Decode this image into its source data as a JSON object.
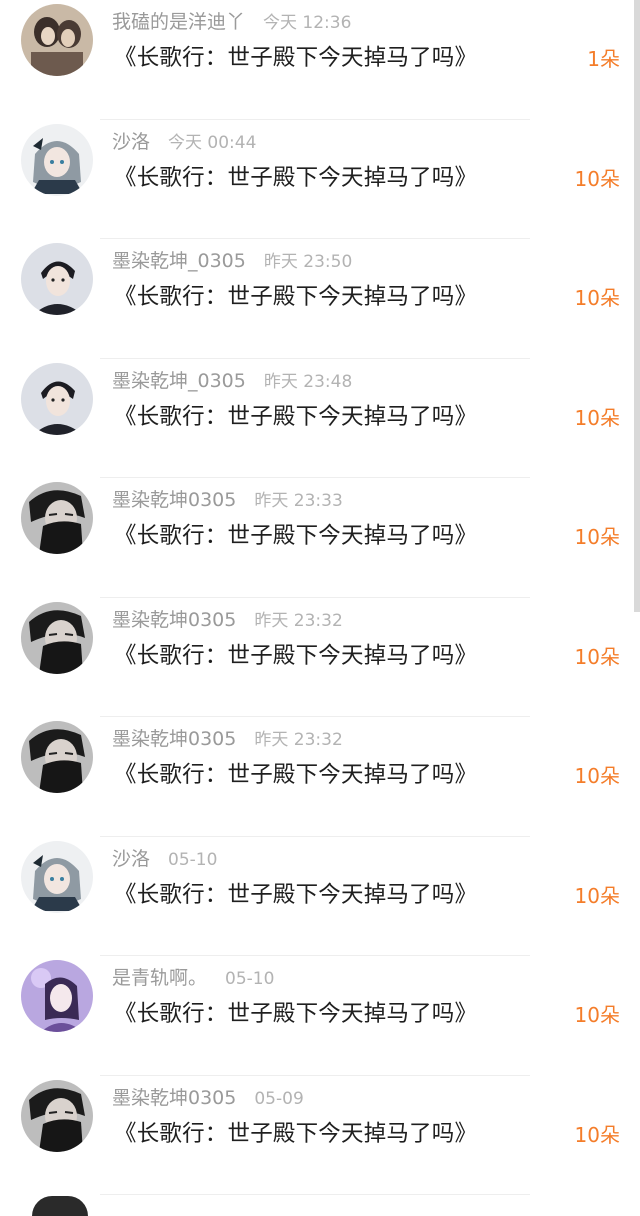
{
  "gift_list": {
    "rows": [
      {
        "user": "我磕的是洋迪丫",
        "time": "今天 12:36",
        "gift": "《长歌行：世子殿下今天掉马了吗》",
        "count": "1朵",
        "avatar_icon": "couple-illustration-avatar"
      },
      {
        "user": "沙洛",
        "time": "今天 00:44",
        "gift": "《长歌行：世子殿下今天掉马了吗》",
        "count": "10朵",
        "avatar_icon": "anime-girl-avatar"
      },
      {
        "user": "墨染乾坤_0305",
        "time": "昨天 23:50",
        "gift": "《长歌行：世子殿下今天掉马了吗》",
        "count": "10朵",
        "avatar_icon": "man-portrait-avatar"
      },
      {
        "user": "墨染乾坤_0305",
        "time": "昨天 23:48",
        "gift": "《长歌行：世子殿下今天掉马了吗》",
        "count": "10朵",
        "avatar_icon": "man-portrait-avatar"
      },
      {
        "user": "墨染乾坤0305",
        "time": "昨天 23:33",
        "gift": "《长歌行：世子殿下今天掉马了吗》",
        "count": "10朵",
        "avatar_icon": "masked-man-avatar"
      },
      {
        "user": "墨染乾坤0305",
        "time": "昨天 23:32",
        "gift": "《长歌行：世子殿下今天掉马了吗》",
        "count": "10朵",
        "avatar_icon": "masked-man-avatar"
      },
      {
        "user": "墨染乾坤0305",
        "time": "昨天 23:32",
        "gift": "《长歌行：世子殿下今天掉马了吗》",
        "count": "10朵",
        "avatar_icon": "masked-man-avatar"
      },
      {
        "user": "沙洛",
        "time": "05-10",
        "gift": "《长歌行：世子殿下今天掉马了吗》",
        "count": "10朵",
        "avatar_icon": "anime-girl-avatar"
      },
      {
        "user": "是青轨啊。",
        "time": "05-10",
        "gift": "《长歌行：世子殿下今天掉马了吗》",
        "count": "10朵",
        "avatar_icon": "purple-girl-avatar"
      },
      {
        "user": "墨染乾坤0305",
        "time": "05-09",
        "gift": "《长歌行：世子殿下今天掉马了吗》",
        "count": "10朵",
        "avatar_icon": "masked-man-avatar"
      }
    ]
  },
  "colors": {
    "count": "#f47d2a",
    "username": "#9a9a9a",
    "gift_text": "#1f1f1f"
  }
}
